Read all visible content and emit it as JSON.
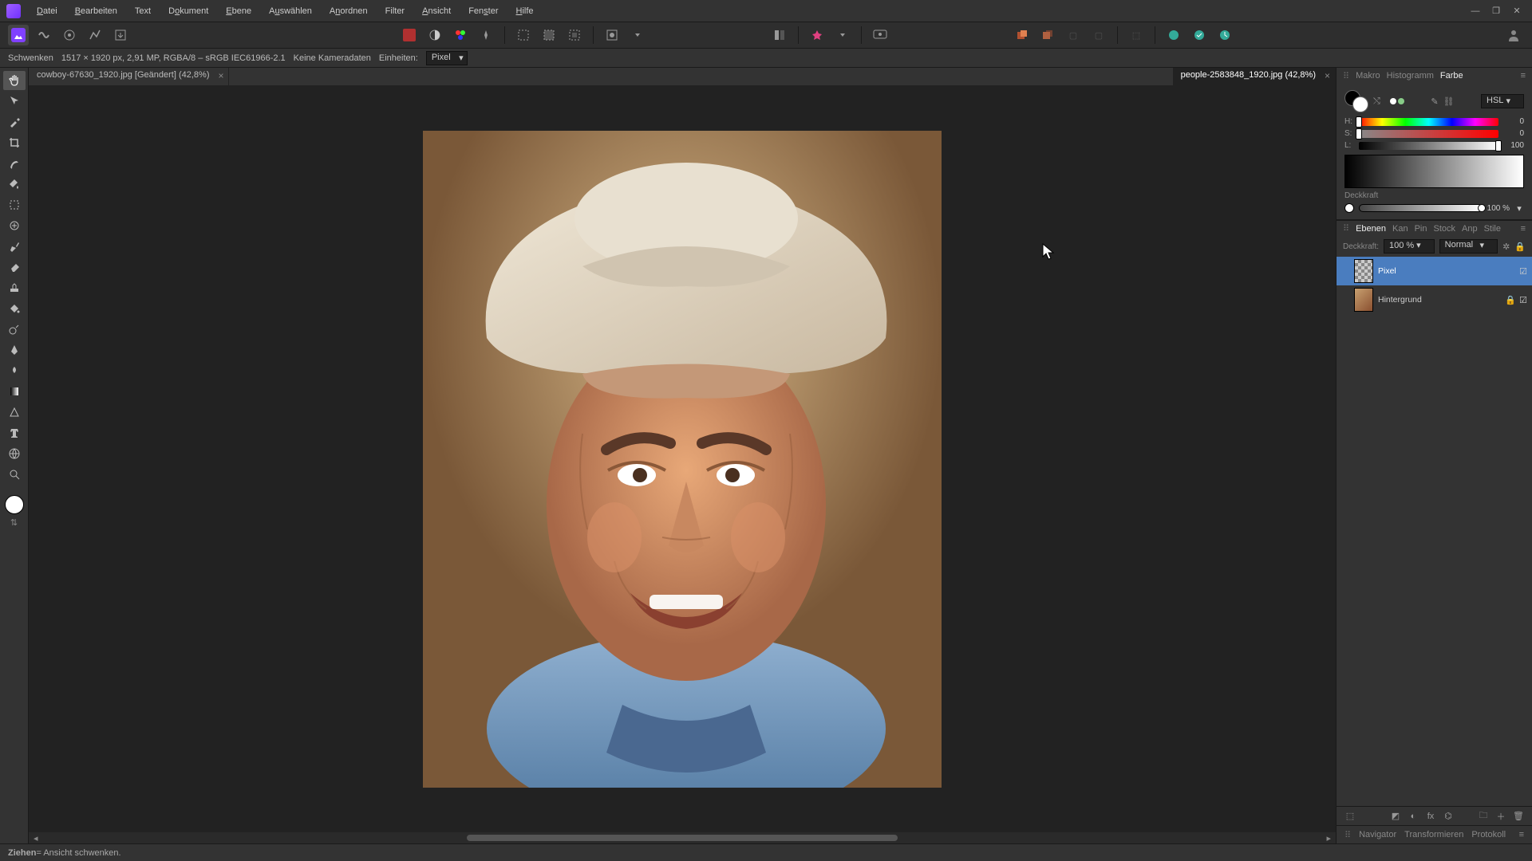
{
  "menu": {
    "items": [
      "Datei",
      "Bearbeiten",
      "Text",
      "Dokument",
      "Ebene",
      "Auswählen",
      "Anordnen",
      "Filter",
      "Ansicht",
      "Fenster",
      "Hilfe"
    ]
  },
  "contextbar": {
    "tool_name": "Schwenken",
    "doc_info": "1517 × 1920 px, 2,91 MP, RGBA/8 – sRGB IEC61966-2.1",
    "camera_data": "Keine Kameradaten",
    "units_label": "Einheiten:",
    "units_value": "Pixel"
  },
  "tabs": [
    {
      "title": "cowboy-67630_1920.jpg [Geändert] (42,8%)",
      "active": false
    },
    {
      "title": "people-2583848_1920.jpg (42,8%)",
      "active": true
    }
  ],
  "panels": {
    "top_right_tabs": [
      "Makro",
      "Histogramm",
      "Farbe"
    ],
    "color_mode": "HSL",
    "hsl": {
      "h_label": "H:",
      "h_val": "0",
      "s_label": "S:",
      "s_val": "0",
      "l_label": "L:",
      "l_val": "100"
    },
    "opacity_label": "Deckkraft",
    "opacity_value": "100 %"
  },
  "layers": {
    "tabs": [
      "Ebenen",
      "Kan",
      "Pin",
      "Stock",
      "Anp",
      "Stile"
    ],
    "opacity_label": "Deckkraft:",
    "opacity_value": "100 %",
    "blend_mode": "Normal",
    "items": [
      {
        "name": "Pixel",
        "selected": true,
        "bg": false
      },
      {
        "name": "Hintergrund",
        "selected": false,
        "bg": true
      }
    ]
  },
  "bottom_tabs": [
    "Navigator",
    "Transformieren",
    "Protokoll"
  ],
  "statusbar": {
    "drag_label": "Ziehen",
    "drag_action": " = Ansicht schwenken."
  },
  "colors": {
    "accent": "#4a7dbf",
    "bg": "#333333",
    "canvas": "#222222"
  }
}
